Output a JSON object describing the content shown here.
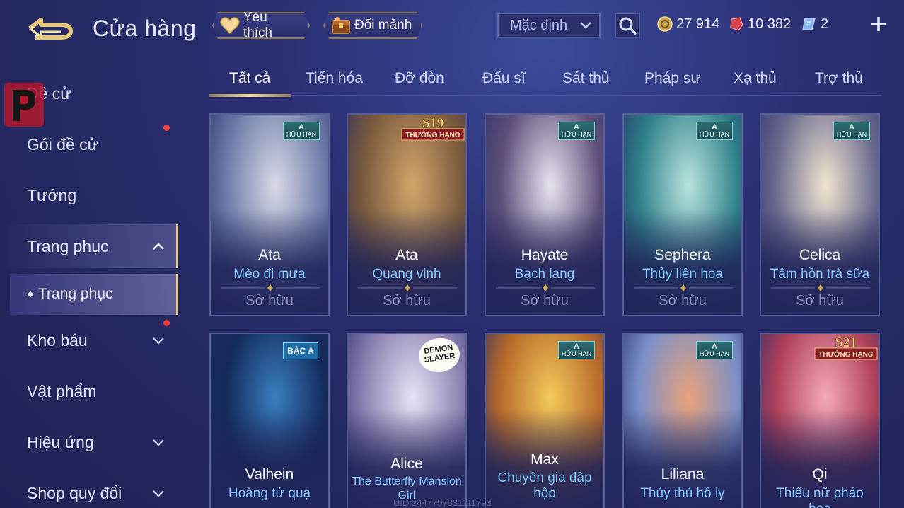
{
  "header": {
    "title": "Cửa hàng",
    "favorite_label": "Yêu thích",
    "fragment_label": "Đổi mảnh",
    "sort": {
      "selected": "Mặc định"
    },
    "currencies": {
      "gold": "27 914",
      "ruby": "10 382",
      "voucher": "2"
    }
  },
  "sidebar": {
    "items": [
      {
        "label": "Đề cử"
      },
      {
        "label": "Gói đề cử"
      },
      {
        "label": "Tướng"
      },
      {
        "label": "Trang phục"
      },
      {
        "label": "Trang phục"
      },
      {
        "label": "Kho báu"
      },
      {
        "label": "Vật phẩm"
      },
      {
        "label": "Hiệu ứng"
      },
      {
        "label": "Shop quy đổi"
      }
    ]
  },
  "tabs": [
    {
      "label": "Tất cả"
    },
    {
      "label": "Tiến hóa"
    },
    {
      "label": "Đỡ đòn"
    },
    {
      "label": "Đấu sĩ"
    },
    {
      "label": "Sát thủ"
    },
    {
      "label": "Pháp sư"
    },
    {
      "label": "Xạ thủ"
    },
    {
      "label": "Trợ thủ"
    }
  ],
  "badges": {
    "a_grade": "A",
    "a_limited": "HỮU HẠN",
    "s19": "S19",
    "s21": "S21",
    "rank": "THƯỞNG HẠNG",
    "bac_a": "BẬC A",
    "ds1": "DEMON",
    "ds2": "SLAYER"
  },
  "cards": [
    {
      "hero": "Ata",
      "skin": "Mèo đi mưa",
      "status": "Sở hữu",
      "colors": [
        "#6c7aa8",
        "#d8d8e6"
      ]
    },
    {
      "hero": "Ata",
      "skin": "Quang vinh",
      "status": "Sở hữu",
      "colors": [
        "#7a5a3c",
        "#d1a46a"
      ]
    },
    {
      "hero": "Hayate",
      "skin": "Bạch lang",
      "status": "Sở hữu",
      "colors": [
        "#5d4f7a",
        "#e8e2ee"
      ]
    },
    {
      "hero": "Sephera",
      "skin": "Thủy liên hoa",
      "status": "Sở hữu",
      "colors": [
        "#2f7f8a",
        "#b7e4dd"
      ]
    },
    {
      "hero": "Celica",
      "skin": "Tâm hồn trà sữa",
      "status": "Sở hữu",
      "colors": [
        "#6a6a8e",
        "#f0e4d0"
      ]
    },
    {
      "hero": "Valhein",
      "skin": "Hoàng tử quạ",
      "colors": [
        "#132a5a",
        "#3a7fc0"
      ]
    },
    {
      "hero": "Alice",
      "skin": "The Butterfly Mansion Girl",
      "colors": [
        "#8a7fb0",
        "#e7e2f4"
      ]
    },
    {
      "hero": "Max",
      "skin": "Chuyên gia đập hộp",
      "colors": [
        "#b86a2a",
        "#f2c95a"
      ]
    },
    {
      "hero": "Liliana",
      "skin": "Thủy thủ hồ ly",
      "colors": [
        "#7a8fc8",
        "#e8a27a"
      ]
    },
    {
      "hero": "Qi",
      "skin": "Thiếu nữ pháo hoa",
      "colors": [
        "#b0405a",
        "#f4a8b8"
      ]
    }
  ],
  "uid": "UID:2447757831111793"
}
